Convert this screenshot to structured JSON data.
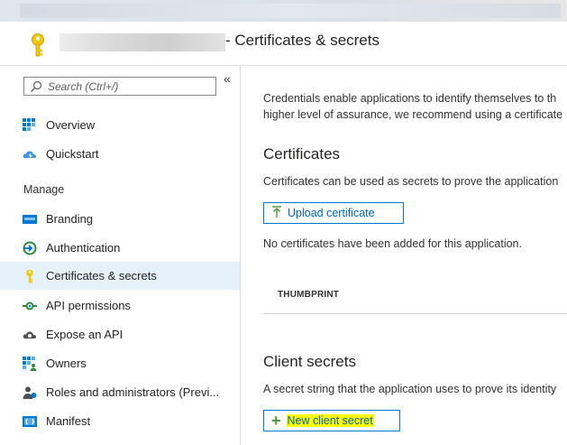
{
  "header": {
    "title": "- Certificates & secrets"
  },
  "search": {
    "placeholder": "Search (Ctrl+/)"
  },
  "sidebar": {
    "collapse_label": "«",
    "overview": "Overview",
    "quickstart": "Quickstart",
    "manage_heading": "Manage",
    "items": [
      "Branding",
      "Authentication",
      "Certificates & secrets",
      "API permissions",
      "Expose an API",
      "Owners",
      "Roles and administrators (Previ...",
      "Manifest"
    ],
    "active_item": "Certificates & secrets"
  },
  "main": {
    "intro_line1": "Credentials enable applications to identify themselves to th",
    "intro_line2": "higher level of assurance, we recommend using a certificate",
    "certificates": {
      "heading": "Certificates",
      "description": "Certificates can be used as secrets to prove the application",
      "upload_button": "Upload certificate",
      "empty_text": "No certificates have been added for this application.",
      "column_thumbprint": "THUMBPRINT"
    },
    "client_secrets": {
      "heading": "Client secrets",
      "description": "A secret string that the application uses to prove its identity",
      "new_button": "New client secret"
    }
  },
  "colors": {
    "accent": "#0078d4",
    "active_nav_bg": "#e5f1fb",
    "highlight": "#ffff00",
    "key_icon": "#f2c811"
  }
}
